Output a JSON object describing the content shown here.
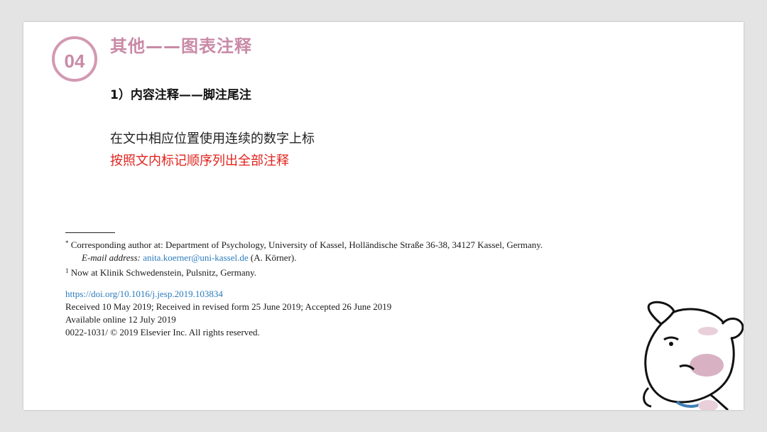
{
  "badge": "04",
  "title": "其他——图表注释",
  "subtitle": "1）内容注释——脚注尾注",
  "body_lines": [
    "在文中相应位置使用连续的数字上标",
    "按照文内标记顺序列出全部注释"
  ],
  "footnotes": {
    "star_mark": "*",
    "corresponding": "Corresponding author at: Department of Psychology, University of Kassel, Holländische Straße 36-38, 34127 Kassel, Germany.",
    "email_label": "E-mail address:",
    "email": "anita.koerner@uni-kassel.de",
    "email_name": "(A. Körner).",
    "note1_mark": "1",
    "note1": "Now at Klinik Schwedenstein, Pulsnitz, Germany."
  },
  "article_info": {
    "doi": "https://doi.org/10.1016/j.jesp.2019.103834",
    "received": "Received 10 May 2019; Received in revised form 25 June 2019; Accepted 26 June 2019",
    "available": "Available online 12 July 2019",
    "copyright": "0022-1031/ © 2019 Elsevier Inc. All rights reserved."
  },
  "colors": {
    "accent": "#c98aa6",
    "highlight": "#e0231d",
    "link": "#2a7bbd"
  }
}
